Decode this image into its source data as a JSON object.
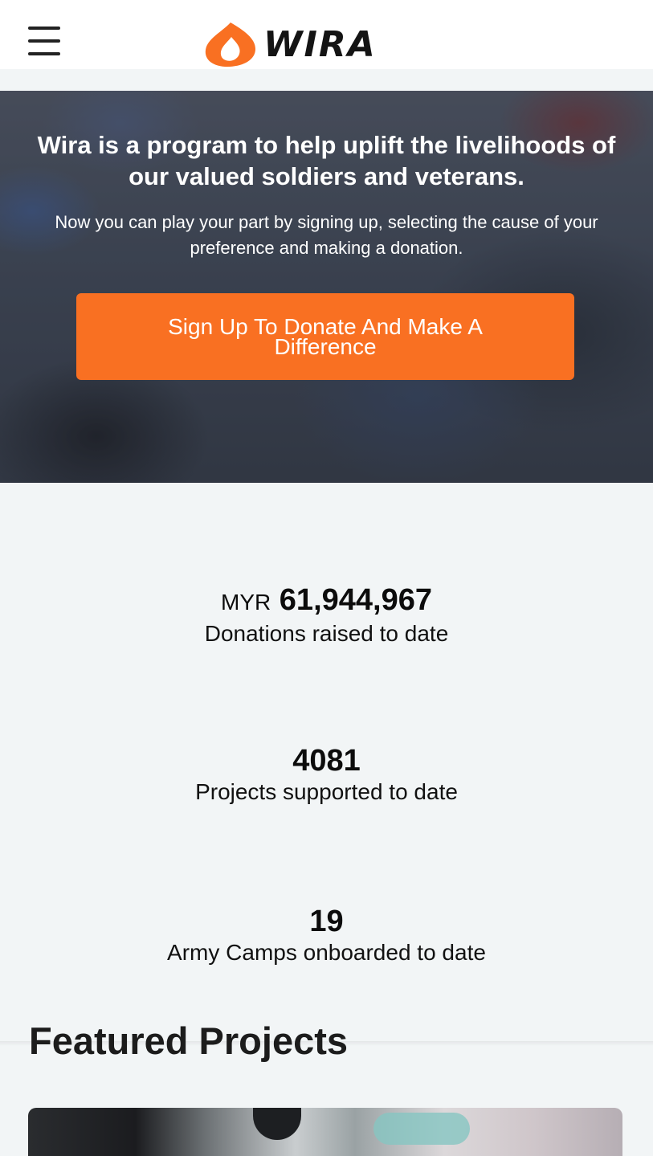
{
  "header": {
    "menu_icon": "hamburger-menu-icon",
    "logo_text": "WIRA",
    "logo_color": "#f97022"
  },
  "hero": {
    "title": "Wira is a program to help uplift the livelihoods of our valued soldiers and veterans.",
    "subtitle": "Now you can play your part by signing up, selecting the cause of your preference and making a donation.",
    "cta_label": "Sign Up To Donate And Make A Difference",
    "cta_color": "#f97022"
  },
  "stats": {
    "donations": {
      "prefix": "MYR",
      "value": "61,944,967",
      "label": "Donations raised to date"
    },
    "projects": {
      "value": "4081",
      "label": "Projects supported to date"
    },
    "camps": {
      "value": "19",
      "label": "Army Camps onboarded to date"
    }
  },
  "featured": {
    "title": "Featured Projects"
  }
}
